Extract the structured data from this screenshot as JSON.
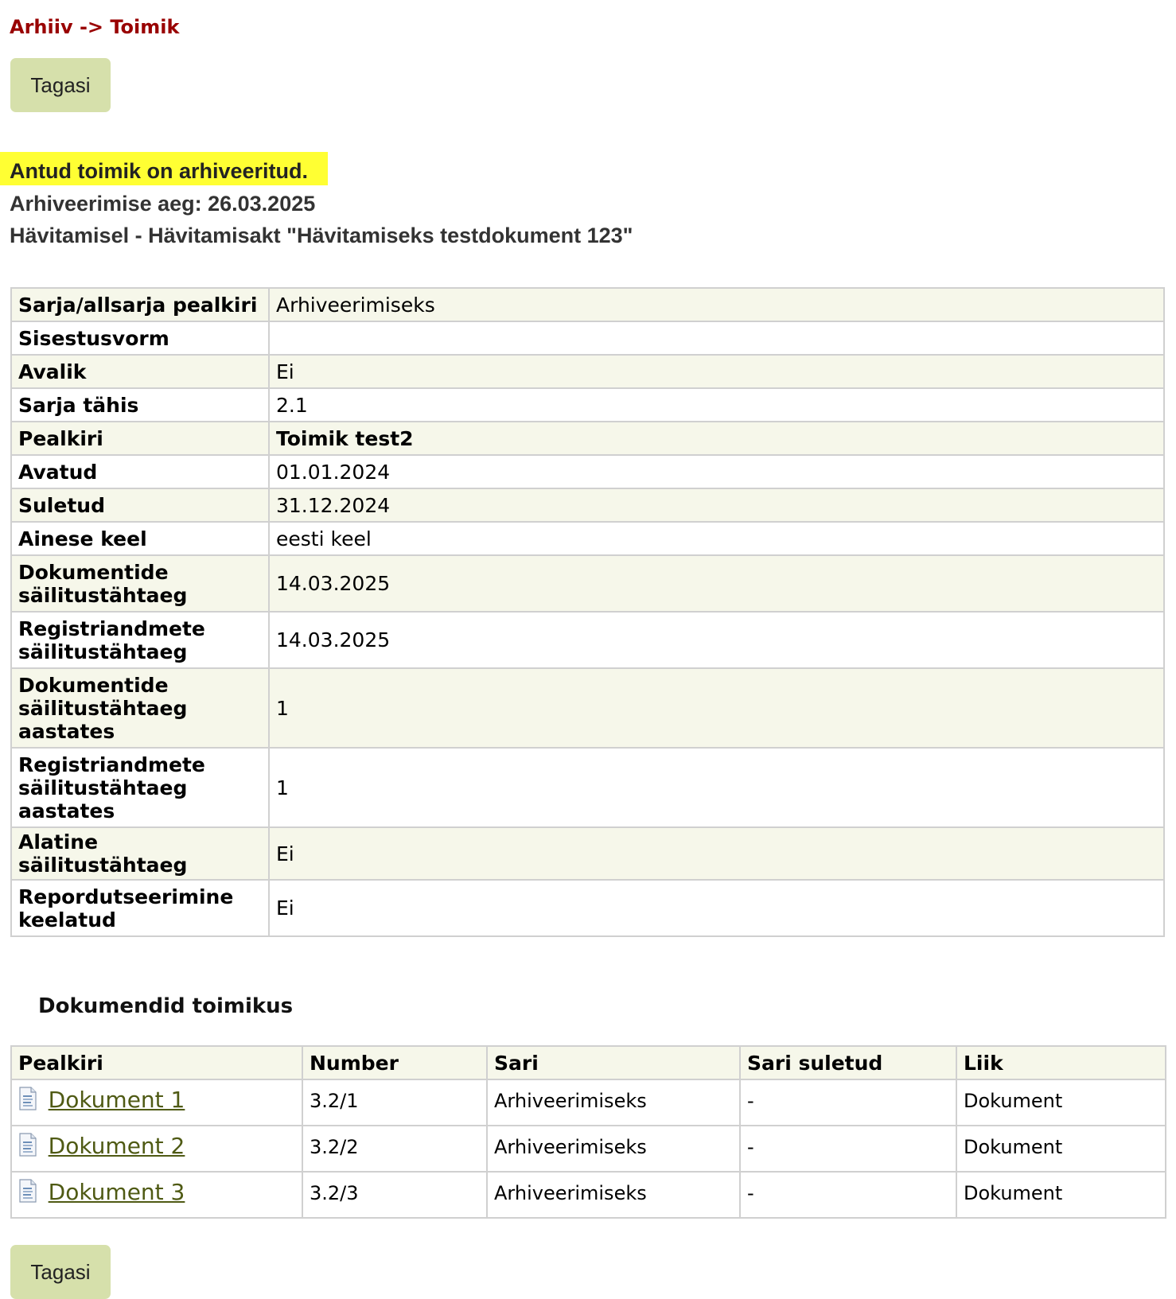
{
  "breadcrumb": "Arhiiv -> Toimik",
  "buttons": {
    "back_label": "Tagasi"
  },
  "status": {
    "archived_notice": "Antud toimik on arhiveeritud.",
    "archive_time": "Arhiveerimise aeg: 26.03.2025",
    "destruction": "Hävitamisel - Hävitamisakt \"Hävitamiseks testdokument 123\""
  },
  "info_table": [
    {
      "label": "Sarja/allsarja pealkiri",
      "value": "Arhiveerimiseks"
    },
    {
      "label": "Sisestusvorm",
      "value": ""
    },
    {
      "label": "Avalik",
      "value": "Ei"
    },
    {
      "label": "Sarja tähis",
      "value": "2.1"
    },
    {
      "label": "Pealkiri",
      "value": "Toimik test2"
    },
    {
      "label": "Avatud",
      "value": "01.01.2024"
    },
    {
      "label": "Suletud",
      "value": "31.12.2024"
    },
    {
      "label": "Ainese keel",
      "value": "eesti keel"
    },
    {
      "label": "Dokumentide säilitustähtaeg",
      "value": "14.03.2025"
    },
    {
      "label": "Registriandmete säilitustähtaeg",
      "value": "14.03.2025"
    },
    {
      "label": "Dokumentide säilitustähtaeg aastates",
      "value": "1"
    },
    {
      "label": "Registriandmete säilitustähtaeg aastates",
      "value": "1"
    },
    {
      "label": "Alatine säilitustähtaeg",
      "value": "Ei"
    },
    {
      "label": "Repordutseerimine keelatud",
      "value": "Ei"
    }
  ],
  "documents": {
    "section_title": "Dokumendid toimikus",
    "columns": [
      "Pealkiri",
      "Number",
      "Sari",
      "Sari suletud",
      "Liik"
    ],
    "rows": [
      {
        "title": "Dokument 1",
        "number": "3.2/1",
        "series": "Arhiveerimiseks",
        "series_closed": "-",
        "type": "Dokument"
      },
      {
        "title": "Dokument 2",
        "number": "3.2/2",
        "series": "Arhiveerimiseks",
        "series_closed": "-",
        "type": "Dokument"
      },
      {
        "title": "Dokument 3",
        "number": "3.2/3",
        "series": "Arhiveerimiseks",
        "series_closed": "-",
        "type": "Dokument"
      }
    ],
    "row_icon": "document-icon"
  },
  "colors": {
    "breadcrumb": "#990000",
    "button_bg": "#d6e0ab",
    "highlight": "#ffff33",
    "row_alt": "#f6f7ea",
    "link": "#4f5a14"
  }
}
